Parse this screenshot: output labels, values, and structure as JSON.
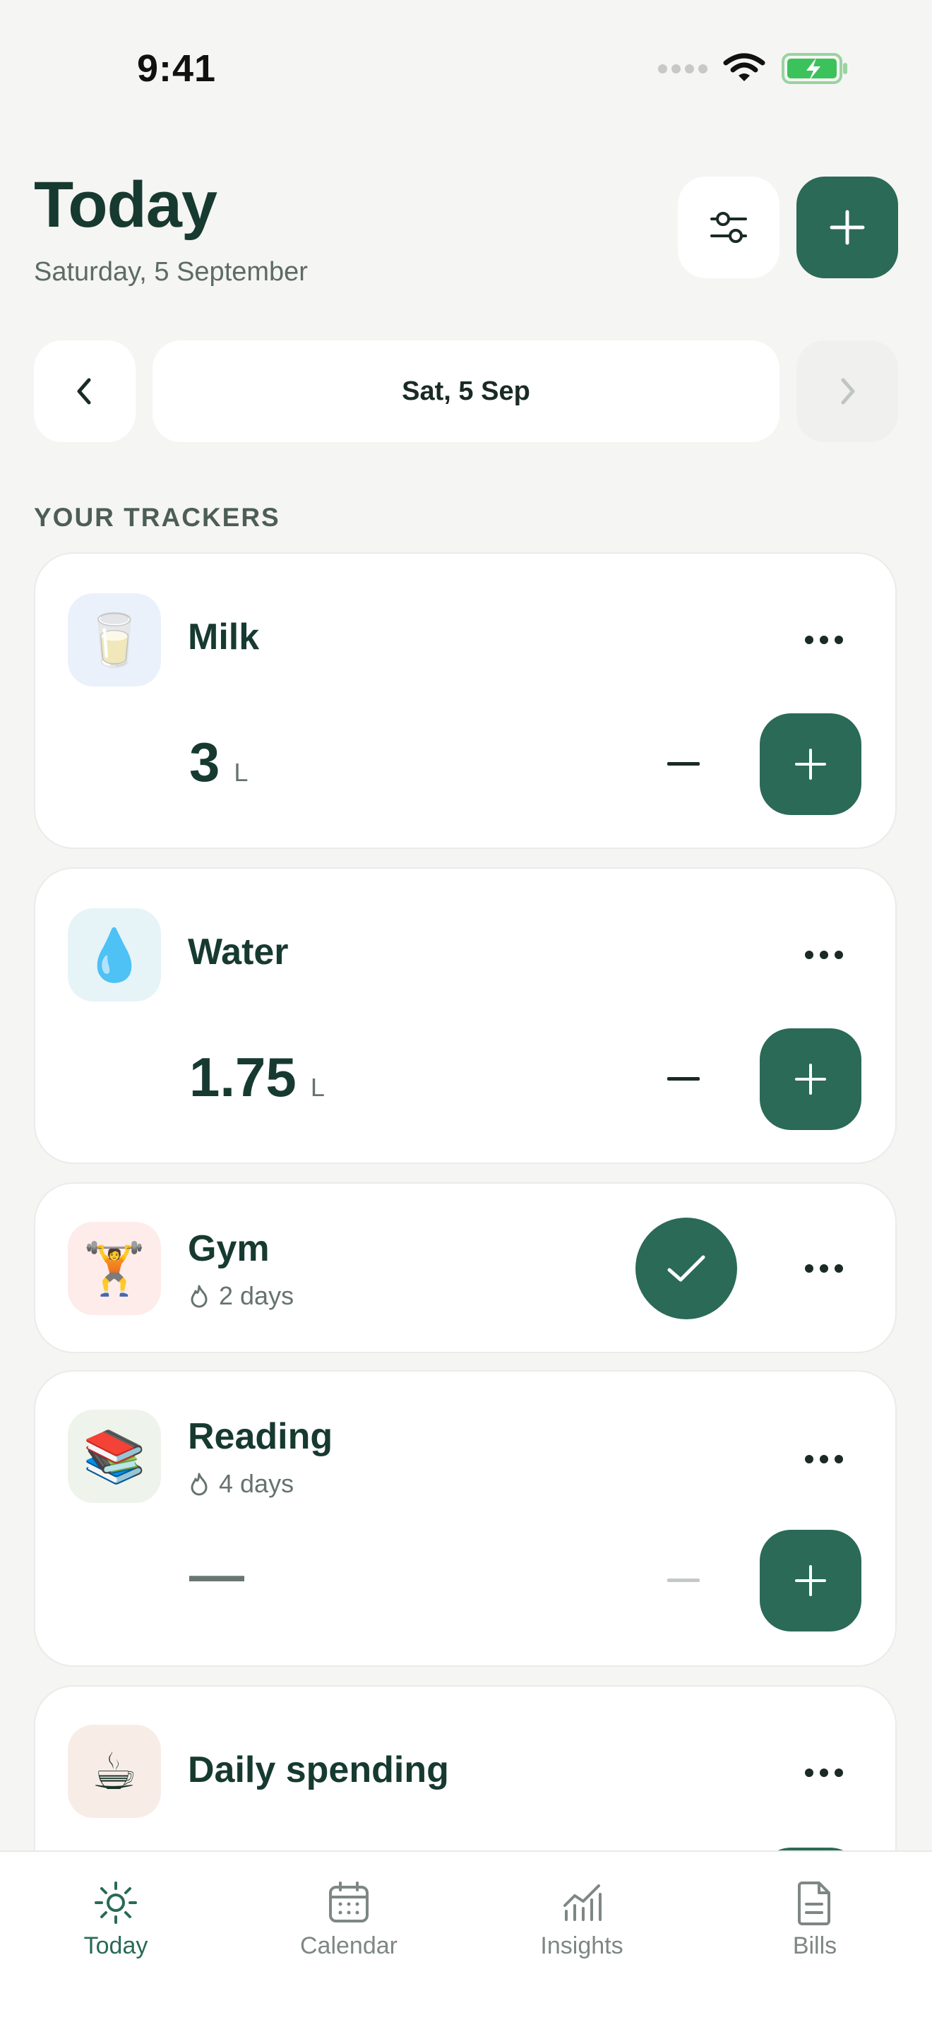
{
  "status": {
    "time": "9:41"
  },
  "header": {
    "title": "Today",
    "subtitle": "Saturday, 5 September"
  },
  "date_nav": {
    "label": "Sat, 5 Sep"
  },
  "section": {
    "label": "YOUR TRACKERS"
  },
  "trackers": [
    {
      "name": "Milk",
      "icon": "🥛",
      "value": "3",
      "unit": "L",
      "tile_color": "#eaf1fb"
    },
    {
      "name": "Water",
      "icon": "💧",
      "value": "1.75",
      "unit": "L",
      "tile_color": "#e6f4f8"
    },
    {
      "name": "Gym",
      "icon": "🏋️",
      "streak": "2 days",
      "tile_color": "#fdecea"
    },
    {
      "name": "Reading",
      "icon": "📚",
      "streak": "4 days",
      "value": "—",
      "tile_color": "#eef3ec"
    },
    {
      "name": "Daily spending",
      "icon": "☕",
      "tile_color": "#f8ece6"
    }
  ],
  "tabs": [
    {
      "label": "Today",
      "active": true
    },
    {
      "label": "Calendar"
    },
    {
      "label": "Insights"
    },
    {
      "label": "Bills"
    }
  ],
  "colors": {
    "accent": "#2a6a57",
    "background": "#f5f5f3",
    "text": "#173a30"
  }
}
